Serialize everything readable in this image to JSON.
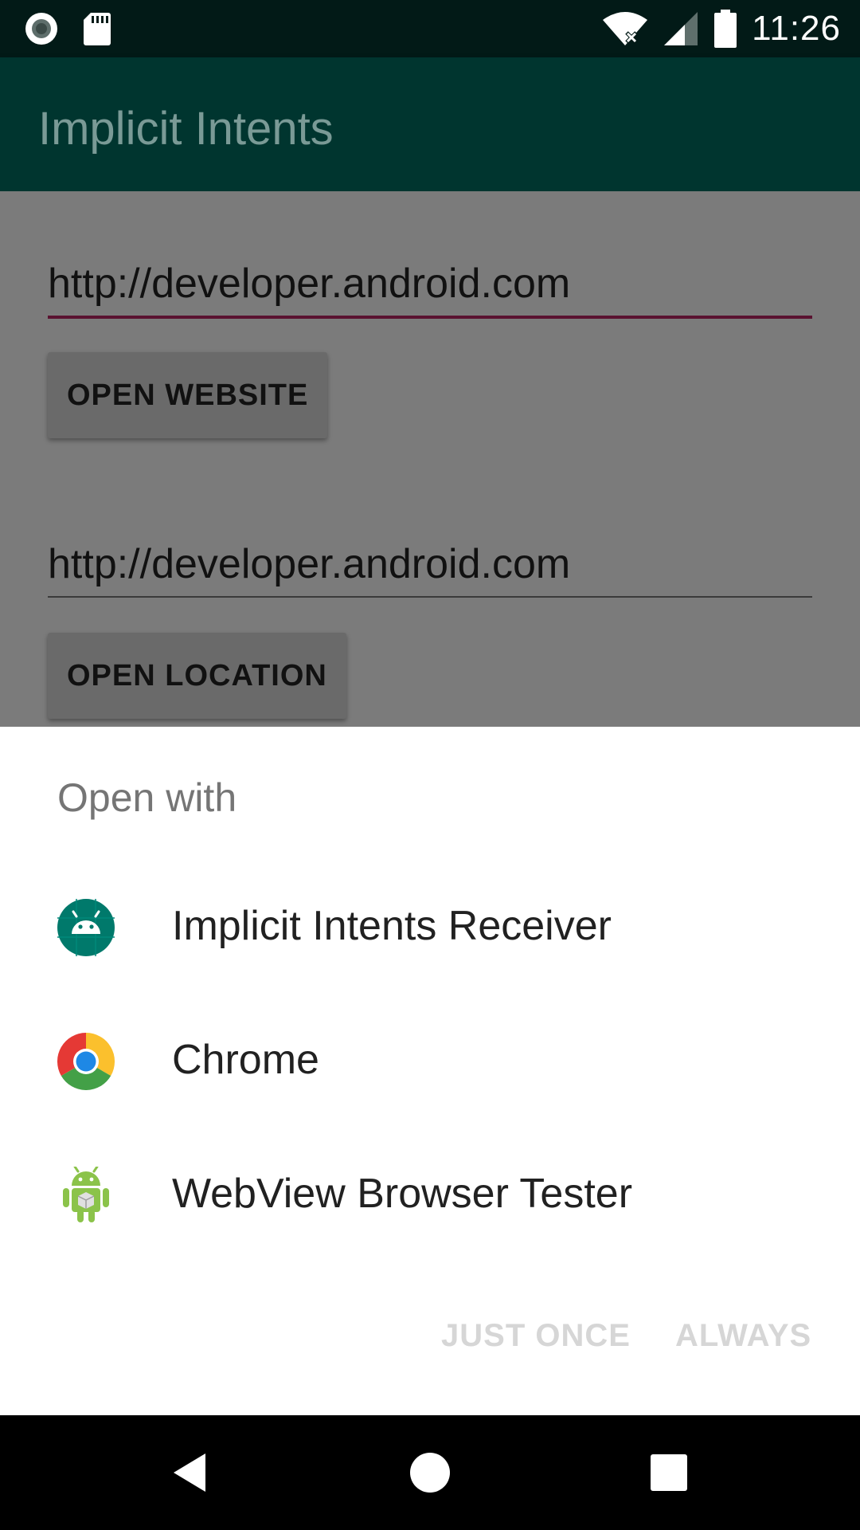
{
  "status_bar": {
    "time": "11:26",
    "left_icons": [
      "record-icon",
      "sd-card-icon"
    ],
    "right_icons": [
      "wifi-icon",
      "signal-icon",
      "battery-icon"
    ]
  },
  "app_bar": {
    "title": "Implicit Intents"
  },
  "content": {
    "website_field_value": "http://developer.android.com",
    "open_website_label": "OPEN WEBSITE",
    "location_field_value": "http://developer.android.com",
    "open_location_label": "OPEN LOCATION"
  },
  "sheet": {
    "title": "Open with",
    "apps": [
      {
        "label": "Implicit Intents Receiver",
        "icon": "android-app-icon"
      },
      {
        "label": "Chrome",
        "icon": "chrome-icon"
      },
      {
        "label": "WebView Browser Tester",
        "icon": "android-robot-icon"
      }
    ],
    "just_once_label": "JUST ONCE",
    "always_label": "ALWAYS"
  },
  "nav_bar": {
    "icons": [
      "back-icon",
      "home-icon",
      "recents-icon"
    ]
  },
  "colors": {
    "status_bar": "#021a17",
    "app_bar": "#00352f",
    "accent_underline": "#5a1230",
    "scrim_background": "#7b7b7b",
    "disabled_button_text": "#d6d6d6"
  }
}
